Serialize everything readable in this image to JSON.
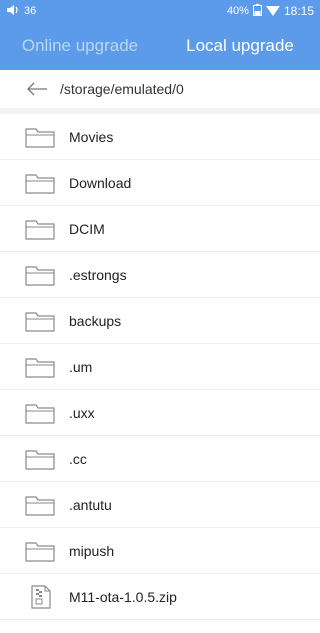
{
  "status_bar": {
    "volume": "36",
    "battery": "40%",
    "time": "18:15"
  },
  "tabs": [
    {
      "label": "Online upgrade",
      "active": false
    },
    {
      "label": "Local upgrade",
      "active": true
    }
  ],
  "path": "/storage/emulated/0",
  "files": [
    {
      "name": "Movies",
      "type": "folder"
    },
    {
      "name": "Download",
      "type": "folder"
    },
    {
      "name": "DCIM",
      "type": "folder"
    },
    {
      "name": ".estrongs",
      "type": "folder"
    },
    {
      "name": "backups",
      "type": "folder"
    },
    {
      "name": ".um",
      "type": "folder"
    },
    {
      "name": ".uxx",
      "type": "folder"
    },
    {
      "name": ".cc",
      "type": "folder"
    },
    {
      "name": ".antutu",
      "type": "folder"
    },
    {
      "name": "mipush",
      "type": "folder"
    },
    {
      "name": "M11-ota-1.0.5.zip",
      "type": "zip"
    }
  ],
  "colors": {
    "accent": "#5b9be9",
    "inactive_tab": "#bcd6f6"
  }
}
